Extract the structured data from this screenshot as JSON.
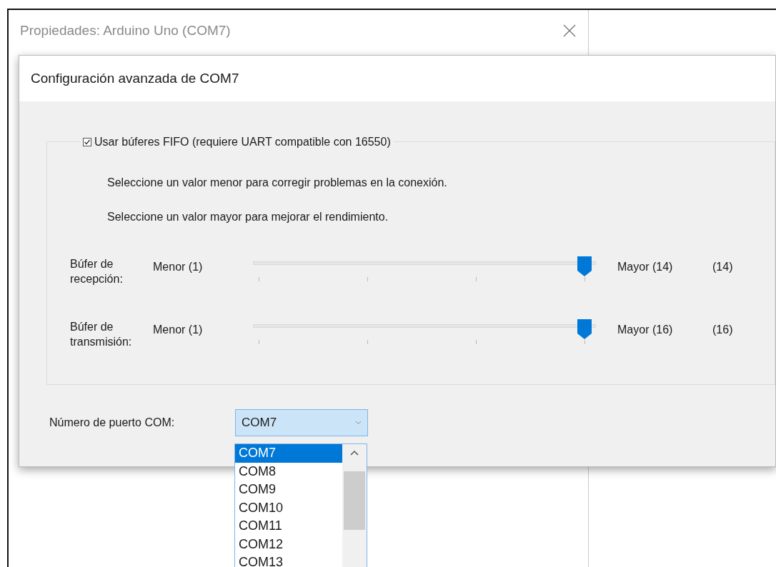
{
  "back_window": {
    "title": "Propiedades: Arduino Uno (COM7)"
  },
  "dialog": {
    "title": "Configuración avanzada de COM7",
    "fifo": {
      "label": "Usar búferes FIFO (requiere UART compatible con 16550)",
      "checked": true
    },
    "hints": [
      "Seleccione un valor menor para corregir problemas en la conexión.",
      "Seleccione un valor mayor para mejorar el rendimiento."
    ],
    "sliders": [
      {
        "label": "Búfer de recepción:",
        "min_label": "Menor (1)",
        "max_label": "Mayor (14)",
        "reading": "(14)",
        "level": 1
      },
      {
        "label": "Búfer de transmisión:",
        "min_label": "Menor (1)",
        "max_label": "Mayor (16)",
        "reading": "(16)",
        "level": 1
      }
    ],
    "com_port": {
      "label": "Número de puerto COM:",
      "value": "COM7",
      "expanded": true,
      "options": [
        {
          "label": "COM7",
          "selected": true
        },
        {
          "label": "COM8",
          "selected": false
        },
        {
          "label": "COM9",
          "selected": false
        },
        {
          "label": "COM10",
          "selected": false
        },
        {
          "label": "COM11",
          "selected": false
        },
        {
          "label": "COM12",
          "selected": false
        },
        {
          "label": "COM13",
          "selected": false
        }
      ]
    }
  }
}
